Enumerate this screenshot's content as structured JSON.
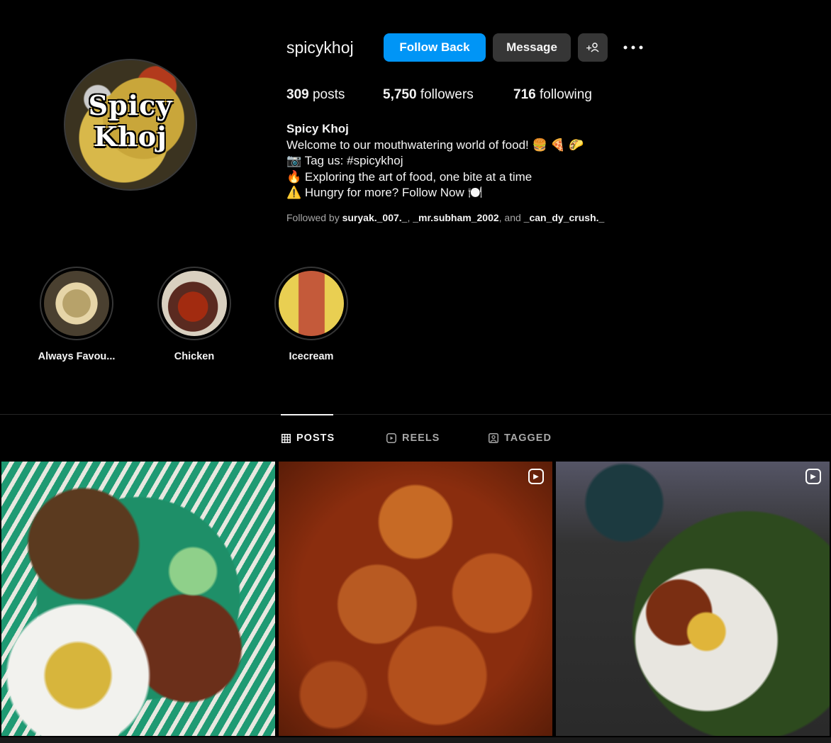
{
  "profile": {
    "username": "spicykhoj",
    "avatar_text_1": "Spicy",
    "avatar_text_2": "Khoj",
    "buttons": {
      "follow_back": "Follow Back",
      "message": "Message",
      "add_user_icon": "add-user-icon",
      "more_icon": "more-horizontal-icon"
    },
    "stats": {
      "posts_count": "309",
      "posts_label": " posts",
      "followers_count": "5,750",
      "followers_label": " followers",
      "following_count": "716",
      "following_label": " following"
    },
    "full_name": "Spicy Khoj",
    "bio_lines": [
      "Welcome to our mouthwatering world of food! 🍔 🍕 🌮",
      "📷 Tag us: #spicykhoj",
      "🔥 Exploring the art of food, one bite at a time",
      "⚠️ Hungry for more? Follow Now 🍽️"
    ],
    "followed_by": {
      "prefix": "Followed by ",
      "user1": "suryak._007._",
      "sep1": ", ",
      "user2": "_mr.subham_2002",
      "sep2": ", and ",
      "user3": "_can_dy_crush._"
    }
  },
  "highlights": [
    {
      "label": "Always Favou..."
    },
    {
      "label": "Chicken"
    },
    {
      "label": "Icecream"
    }
  ],
  "tabs": [
    {
      "label": "POSTS",
      "icon": "grid-icon",
      "active": true
    },
    {
      "label": "REELS",
      "icon": "reels-icon",
      "active": false
    },
    {
      "label": "TAGGED",
      "icon": "tagged-icon",
      "active": false
    }
  ],
  "posts": [
    {
      "type": "image"
    },
    {
      "type": "reel",
      "icon": "reel-icon"
    },
    {
      "type": "reel",
      "icon": "reel-icon"
    }
  ],
  "colors": {
    "background": "#000000",
    "accent": "#0095f6",
    "button_secondary": "#363636"
  }
}
